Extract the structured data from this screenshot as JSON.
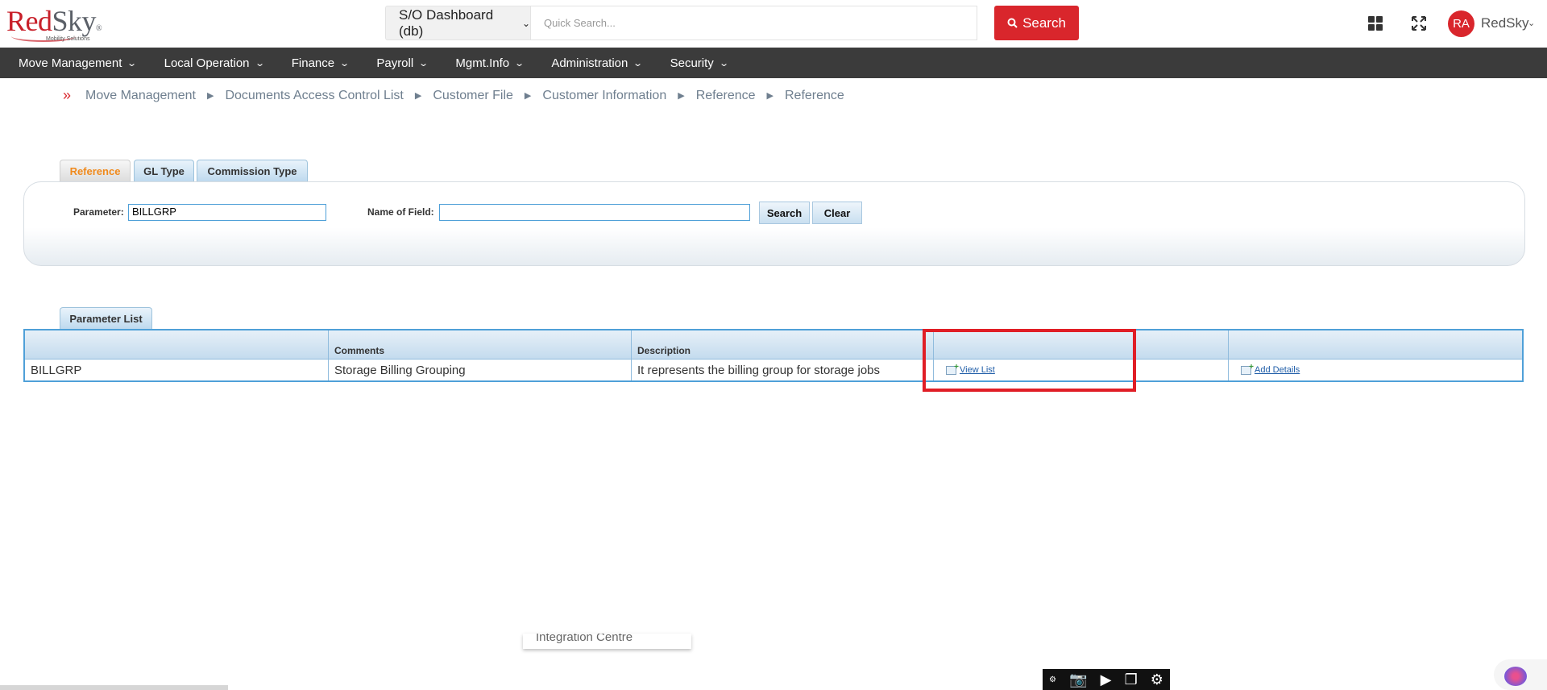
{
  "header": {
    "logo": {
      "brand_red": "Red",
      "brand_gray": "Sky",
      "reg": "®",
      "tagline": "Mobility Solutions"
    },
    "dashboard_select": "S/O Dashboard (db)",
    "quick_search_placeholder": "Quick Search...",
    "search_button": "Search",
    "user_initials": "RA",
    "user_name": "RedSky"
  },
  "nav": {
    "items": [
      {
        "label": "Move Management"
      },
      {
        "label": "Local Operation"
      },
      {
        "label": "Finance"
      },
      {
        "label": "Payroll"
      },
      {
        "label": "Mgmt.Info"
      },
      {
        "label": "Administration"
      },
      {
        "label": "Security"
      }
    ]
  },
  "breadcrumb": [
    "Move Management",
    "Documents Access Control List",
    "Customer File",
    "Customer Information",
    "Reference",
    "Reference"
  ],
  "tabs": [
    {
      "label": "Reference",
      "active": true
    },
    {
      "label": "GL Type",
      "active": false
    },
    {
      "label": "Commission Type",
      "active": false
    }
  ],
  "filter": {
    "parameter_label": "Parameter:",
    "parameter_value": "BILLGRP",
    "name_of_field_label": "Name of Field:",
    "name_of_field_value": "",
    "search_button": "Search",
    "clear_button": "Clear"
  },
  "parameter_list": {
    "tab_label": "Parameter List",
    "columns": [
      "",
      "Comments",
      "Description",
      "",
      ""
    ],
    "rows": [
      {
        "parameter": "BILLGRP",
        "comments": "Storage Billing Grouping",
        "description": "It represents the billing group for storage jobs",
        "view_list": "View List",
        "add_details": "Add Details"
      }
    ]
  },
  "overlay": {
    "popup_fragment": "Integration Centre"
  },
  "colors": {
    "brand_red": "#d9262c",
    "nav_bg": "#3b3b3b",
    "tab_active_text": "#f08a1d",
    "highlight_border": "#e01e26",
    "link": "#1f5da8"
  }
}
